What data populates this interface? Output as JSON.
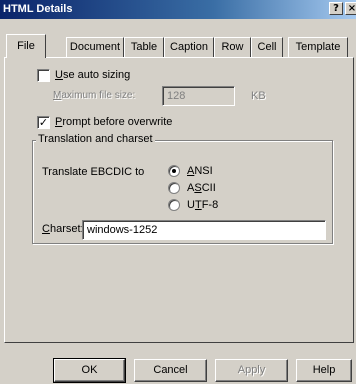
{
  "window": {
    "title": "HTML Details",
    "help_button": "?",
    "close_button": "×"
  },
  "tabs": [
    "File",
    "Document",
    "Table",
    "Caption",
    "Row",
    "Cell",
    "Template"
  ],
  "active_tab": "File",
  "file_tab": {
    "auto_sizing": {
      "label_u": "U",
      "label_rest": "se auto sizing",
      "checked": false
    },
    "max_file_size": {
      "label_u": "M",
      "label_rest": "aximum file size:",
      "value": "128",
      "unit": "KB",
      "enabled": false
    },
    "prompt_overwrite": {
      "label_u": "P",
      "label_rest": "rompt before overwrite",
      "checked": true,
      "check_glyph": "✓"
    },
    "translation_group": {
      "title": "Translation and charset",
      "translate_label": "Translate EBCDIC to",
      "options": [
        {
          "u": "A",
          "rest": "NSI",
          "selected": true
        },
        {
          "pre": "A",
          "u": "S",
          "rest": "CII",
          "selected": false
        },
        {
          "pre": "U",
          "u": "T",
          "rest": "F-8",
          "selected": false
        }
      ],
      "charset_label_u": "C",
      "charset_label_rest": "harset:",
      "charset_value": "windows-1252"
    }
  },
  "buttons": {
    "ok": "OK",
    "cancel": "Cancel",
    "apply": "Apply",
    "help": "Help"
  }
}
